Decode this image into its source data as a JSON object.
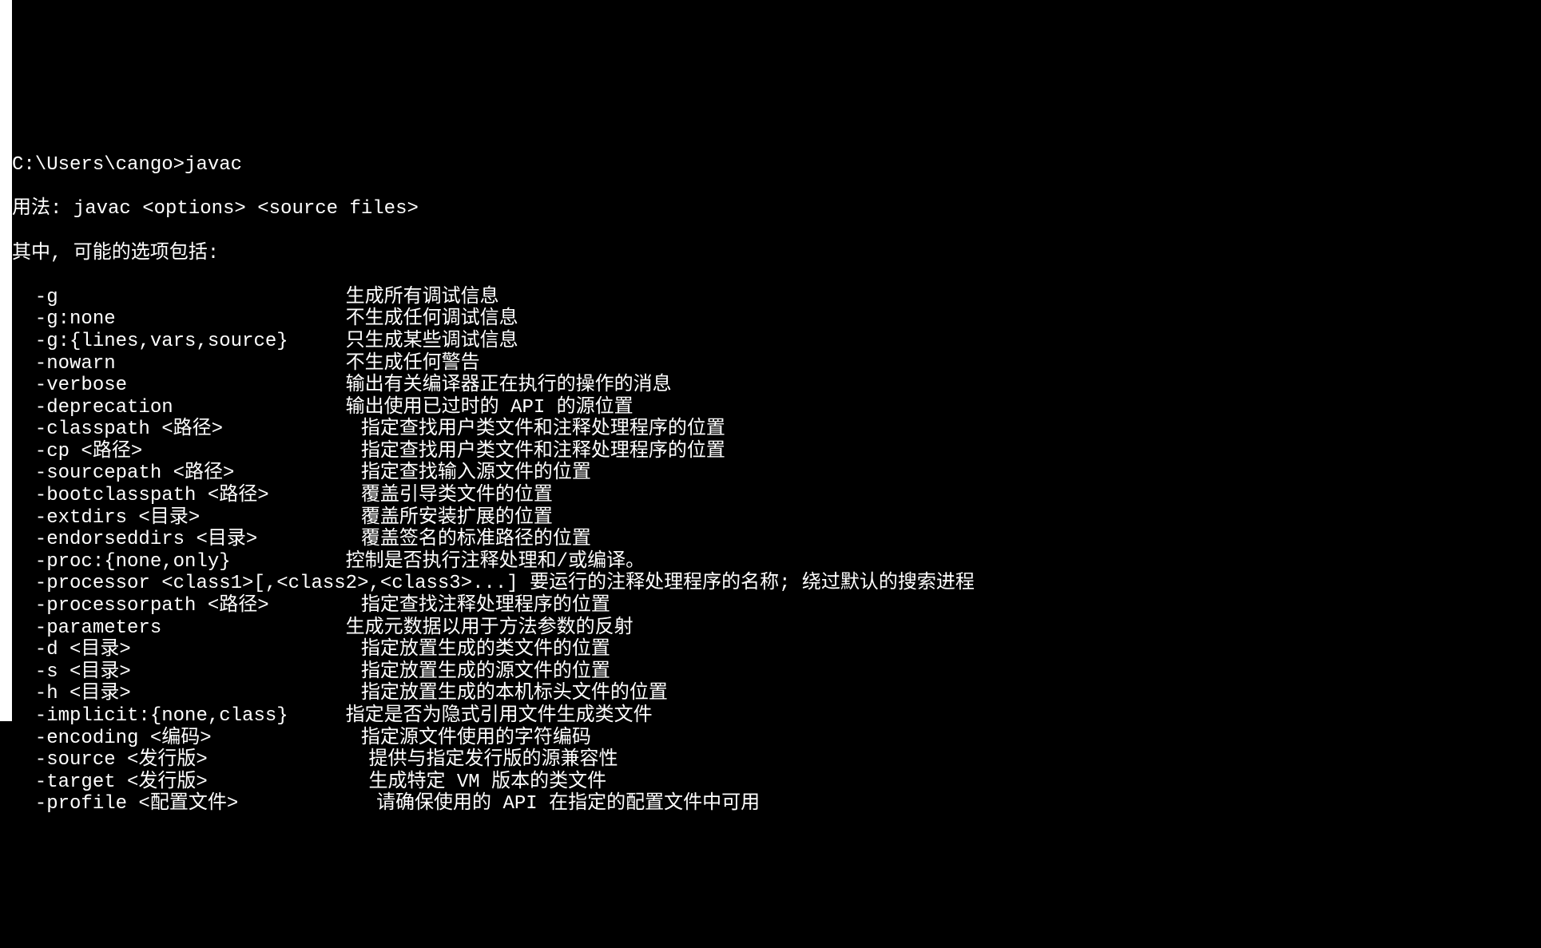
{
  "prompt_line": "C:\\Users\\cango>javac",
  "usage_line": "用法: javac <options> <source files>",
  "intro_line": "其中, 可能的选项包括:",
  "options": [
    {
      "flag": "  -g                         ",
      "desc": "生成所有调试信息"
    },
    {
      "flag": "  -g:none                    ",
      "desc": "不生成任何调试信息"
    },
    {
      "flag": "  -g:{lines,vars,source}     ",
      "desc": "只生成某些调试信息"
    },
    {
      "flag": "  -nowarn                    ",
      "desc": "不生成任何警告"
    },
    {
      "flag": "  -verbose                   ",
      "desc": "输出有关编译器正在执行的操作的消息"
    },
    {
      "flag": "  -deprecation               ",
      "desc": "输出使用已过时的 API 的源位置"
    },
    {
      "flag": "  -classpath <路径>            ",
      "desc": "指定查找用户类文件和注释处理程序的位置"
    },
    {
      "flag": "  -cp <路径>                   ",
      "desc": "指定查找用户类文件和注释处理程序的位置"
    },
    {
      "flag": "  -sourcepath <路径>           ",
      "desc": "指定查找输入源文件的位置"
    },
    {
      "flag": "  -bootclasspath <路径>        ",
      "desc": "覆盖引导类文件的位置"
    },
    {
      "flag": "  -extdirs <目录>              ",
      "desc": "覆盖所安装扩展的位置"
    },
    {
      "flag": "  -endorseddirs <目录>         ",
      "desc": "覆盖签名的标准路径的位置"
    },
    {
      "flag": "  -proc:{none,only}          ",
      "desc": "控制是否执行注释处理和/或编译。"
    },
    {
      "flag": "  -processor <class1>[,<class2>,<class3>...] ",
      "desc": "要运行的注释处理程序的名称; 绕过默认的搜索进程"
    },
    {
      "flag": "  -processorpath <路径>        ",
      "desc": "指定查找注释处理程序的位置"
    },
    {
      "flag": "  -parameters                ",
      "desc": "生成元数据以用于方法参数的反射"
    },
    {
      "flag": "  -d <目录>                    ",
      "desc": "指定放置生成的类文件的位置"
    },
    {
      "flag": "  -s <目录>                    ",
      "desc": "指定放置生成的源文件的位置"
    },
    {
      "flag": "  -h <目录>                    ",
      "desc": "指定放置生成的本机标头文件的位置"
    },
    {
      "flag": "  -implicit:{none,class}     ",
      "desc": "指定是否为隐式引用文件生成类文件"
    },
    {
      "flag": "  -encoding <编码>             ",
      "desc": "指定源文件使用的字符编码"
    },
    {
      "flag": "  -source <发行版>              ",
      "desc": "提供与指定发行版的源兼容性"
    },
    {
      "flag": "  -target <发行版>              ",
      "desc": "生成特定 VM 版本的类文件"
    },
    {
      "flag": "  -profile <配置文件>            ",
      "desc": "请确保使用的 API 在指定的配置文件中可用"
    }
  ]
}
